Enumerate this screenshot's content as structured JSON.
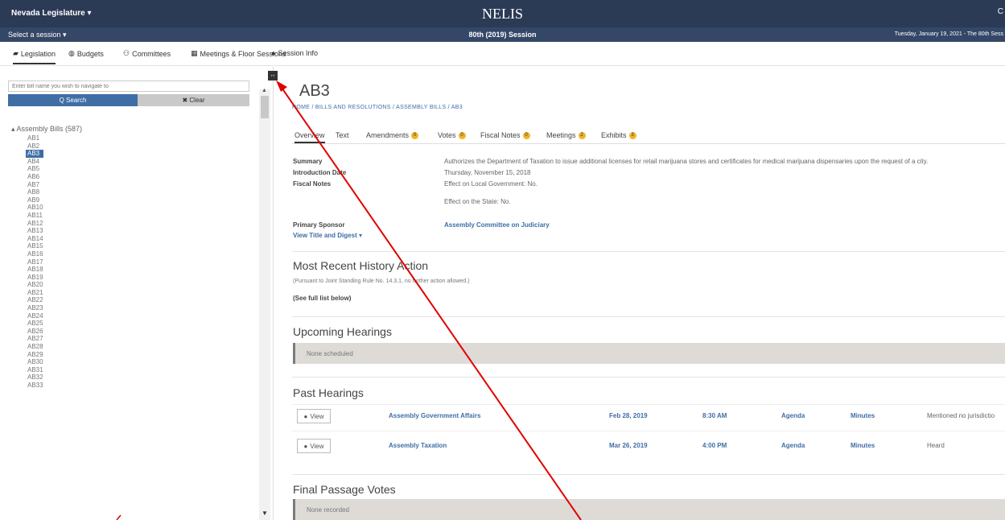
{
  "header": {
    "brand": "Nevada Legislature ▾",
    "title": "NELIS",
    "right_mark": "C"
  },
  "session_bar": {
    "select": "Select a session ▾",
    "session": "80th (2019) Session",
    "date": "Tuesday, January 19, 2021 - The 80th Sess"
  },
  "nav": [
    {
      "icon": "gavel-icon",
      "label": "Legislation"
    },
    {
      "icon": "money-icon",
      "label": "Budgets"
    },
    {
      "icon": "people-icon",
      "label": "Committees"
    },
    {
      "icon": "calendar-icon",
      "label": "Meetings & Floor Sessions"
    },
    {
      "icon": "info-icon",
      "label": "Session Info"
    }
  ],
  "sidebar": {
    "search_placeholder": "Enter bill name you wish to navigate to",
    "search_label": "Q Search",
    "clear_label": "✖ Clear",
    "tree_root": "▴ Assembly Bills (587)",
    "bills": [
      "AB1",
      "AB2",
      "AB3",
      "AB4",
      "AB5",
      "AB6",
      "AB7",
      "AB8",
      "AB9",
      "AB10",
      "AB11",
      "AB12",
      "AB13",
      "AB14",
      "AB15",
      "AB16",
      "AB17",
      "AB18",
      "AB19",
      "AB20",
      "AB21",
      "AB22",
      "AB23",
      "AB24",
      "AB25",
      "AB26",
      "AB27",
      "AB28",
      "AB29",
      "AB30",
      "AB31",
      "AB32",
      "AB33"
    ],
    "selected_bill": "AB3"
  },
  "bill": {
    "title": "AB3",
    "breadcrumb": "HOME / BILLS AND RESOLUTIONS / ASSEMBLY BILLS / AB3",
    "tabs": [
      {
        "label": "Overview",
        "badge": ""
      },
      {
        "label": "Text",
        "badge": ""
      },
      {
        "label": "Amendments",
        "badge": "0"
      },
      {
        "label": "Votes",
        "badge": "0"
      },
      {
        "label": "Fiscal Notes",
        "badge": "0"
      },
      {
        "label": "Meetings",
        "badge": "2"
      },
      {
        "label": "Exhibits",
        "badge": "3"
      }
    ],
    "summary_label": "Summary",
    "summary": "Authorizes the Department of Taxation to issue additional licenses for retail marijuana stores and certificates for medical marijuana dispensaries upon the request of a city.",
    "intro_label": "Introduction Date",
    "intro_date": "Thursday, November 15, 2018",
    "fiscal_label": "Fiscal Notes",
    "fiscal_local": "Effect on Local Government: No.",
    "fiscal_state": "Effect on the State: No.",
    "sponsor_label": "Primary Sponsor",
    "sponsor": "Assembly Committee on Judiciary",
    "view_title": "View Title and Digest ▾"
  },
  "history": {
    "title": "Most Recent History Action",
    "note": "(Pursuant to Joint Standing Rule No. 14.3.1, no further action allowed.)",
    "see_full": "(See full list below)"
  },
  "upcoming": {
    "title": "Upcoming Hearings",
    "empty": "None scheduled"
  },
  "past": {
    "title": "Past Hearings",
    "view_label": "View",
    "rows": [
      {
        "committee": "Assembly Government Affairs",
        "date": "Feb 28, 2019",
        "time": "8:30 AM",
        "agenda": "Agenda",
        "minutes": "Minutes",
        "status": "Mentioned no jurisdictio"
      },
      {
        "committee": "Assembly Taxation",
        "date": "Mar 26, 2019",
        "time": "4:00 PM",
        "agenda": "Agenda",
        "minutes": "Minutes",
        "status": "Heard"
      }
    ]
  },
  "final_votes": {
    "title": "Final Passage Votes",
    "empty": "None recorded"
  },
  "colors": {
    "header": "#2b3a55",
    "accent": "#3f6ea5",
    "badge": "#f0b429",
    "annotation": "#e00000"
  }
}
